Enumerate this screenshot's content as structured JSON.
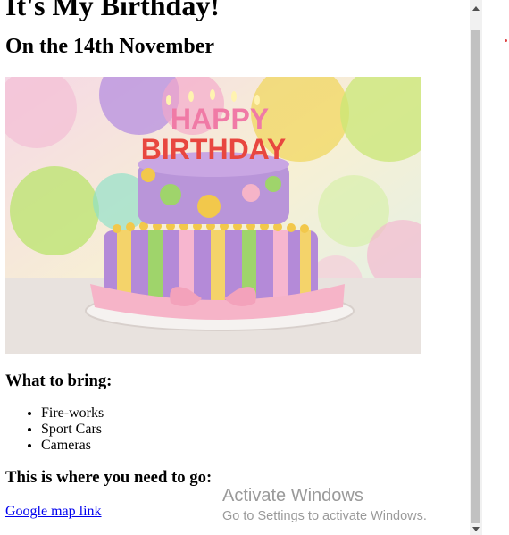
{
  "page": {
    "title": "It's My Birthday!",
    "subtitle": "On the 14th November",
    "bring_heading": "What to bring:",
    "bring_items": [
      "Fire-works",
      "Sport Cars",
      "Cameras"
    ],
    "go_heading": "This is where you need to go:",
    "map_link": "Google map link"
  },
  "cake": {
    "top_text": "HAPPY",
    "bottom_text": "BIRTHDAY"
  },
  "watermark": {
    "title": "Activate Windows",
    "subtitle": "Go to Settings to activate Windows."
  },
  "icons": {
    "scroll_up": "scroll-up-arrow-icon",
    "scroll_down": "scroll-down-arrow-icon"
  }
}
